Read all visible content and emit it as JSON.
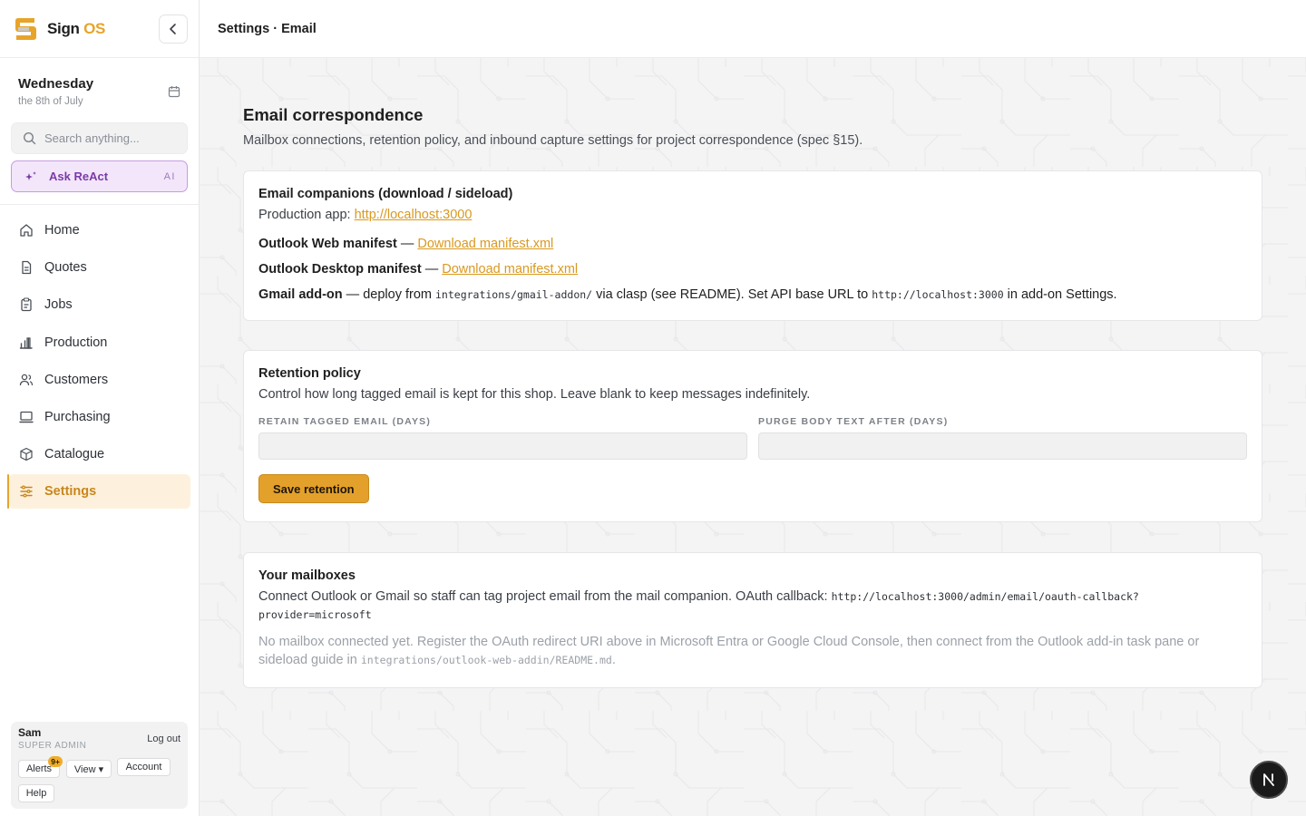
{
  "brand": {
    "name_part1": "Sign ",
    "name_part2": "OS"
  },
  "topbar": {
    "breadcrumb": "Settings · Email"
  },
  "date": {
    "day": "Wednesday",
    "sub": "the 8th of July"
  },
  "search": {
    "placeholder": "Search anything..."
  },
  "ask": {
    "label": "Ask ReAct",
    "tag": "AI"
  },
  "nav": [
    {
      "label": "Home",
      "icon": "home-icon"
    },
    {
      "label": "Quotes",
      "icon": "document-icon"
    },
    {
      "label": "Jobs",
      "icon": "clipboard-icon"
    },
    {
      "label": "Production",
      "icon": "bar-chart-icon"
    },
    {
      "label": "Customers",
      "icon": "users-icon"
    },
    {
      "label": "Purchasing",
      "icon": "monitor-icon"
    },
    {
      "label": "Catalogue",
      "icon": "box-icon"
    },
    {
      "label": "Settings",
      "icon": "sliders-icon",
      "active": true
    }
  ],
  "user": {
    "name": "Sam",
    "role": "SUPER ADMIN",
    "logout": "Log out",
    "alerts": "Alerts",
    "alerts_badge": "9+",
    "view": "View ▾",
    "account": "Account",
    "help": "Help"
  },
  "page": {
    "title": "Email correspondence",
    "subtitle": "Mailbox connections, retention policy, and inbound capture settings for project correspondence (spec §15)."
  },
  "companions": {
    "title": "Email companions (download / sideload)",
    "prod_label": "Production app: ",
    "prod_link": "http://localhost:3000",
    "outlook_web_label": "Outlook Web manifest",
    "outlook_web_sep": " — ",
    "outlook_web_link": "Download manifest.xml",
    "outlook_desktop_label": "Outlook Desktop manifest",
    "outlook_desktop_sep": " — ",
    "outlook_desktop_link": "Download manifest.xml",
    "gmail_label": "Gmail add-on",
    "gmail_text1": " — deploy from ",
    "gmail_code1": "integrations/gmail-addon/",
    "gmail_text2": " via clasp (see README). Set API base URL to ",
    "gmail_code2": "http://localhost:3000",
    "gmail_text3": " in add-on Settings."
  },
  "retention": {
    "title": "Retention policy",
    "desc": "Control how long tagged email is kept for this shop. Leave blank to keep messages indefinitely.",
    "field1_label": "RETAIN TAGGED EMAIL (DAYS)",
    "field1_value": "",
    "field2_label": "PURGE BODY TEXT AFTER (DAYS)",
    "field2_value": "",
    "save_label": "Save retention"
  },
  "mailboxes": {
    "title": "Your mailboxes",
    "desc_text": "Connect Outlook or Gmail so staff can tag project email from the mail companion. OAuth callback: ",
    "callback_line1": "http://localhost:3000/admin/email/oauth-callback?",
    "callback_line2": "provider=microsoft",
    "empty_text": "No mailbox connected yet. Register the OAuth redirect URI above in Microsoft Entra or Google Cloud Console, then connect from the Outlook add-in task pane or sideload guide in ",
    "empty_code": "integrations/outlook-web-addin/README.md",
    "empty_end": "."
  },
  "fab": {
    "letter": "N"
  },
  "colors": {
    "accent": "#e3a12b",
    "ai_purple": "#7a3aa8",
    "link": "#d9991f"
  }
}
